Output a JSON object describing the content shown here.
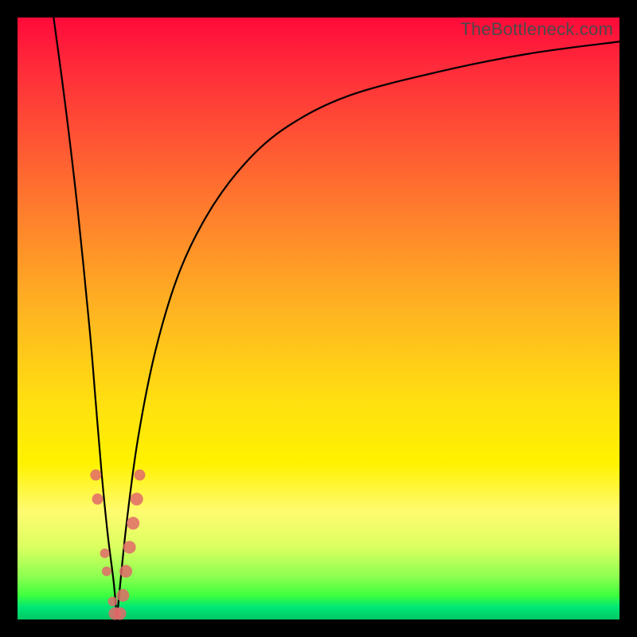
{
  "watermark": "TheBottleneck.com",
  "colors": {
    "frame_border": "#000000",
    "curve": "#000000",
    "dot": "#e06a6a",
    "gradient_top": "#ff0a3a",
    "gradient_bottom": "#00c864"
  },
  "chart_data": {
    "type": "line",
    "title": "",
    "xlabel": "",
    "ylabel": "",
    "xlim": [
      0,
      100
    ],
    "ylim": [
      0,
      100
    ],
    "grid": false,
    "legend": false,
    "series": [
      {
        "name": "left-branch",
        "x": [
          6,
          8,
          10,
          12,
          13,
          14,
          15,
          16,
          16.5
        ],
        "y": [
          100,
          85,
          68,
          48,
          36,
          24,
          14,
          6,
          0
        ]
      },
      {
        "name": "right-branch",
        "x": [
          16.5,
          18,
          20,
          23,
          27,
          32,
          38,
          45,
          55,
          70,
          85,
          100
        ],
        "y": [
          0,
          15,
          30,
          45,
          58,
          68,
          76,
          82,
          87,
          91,
          94,
          96
        ]
      }
    ],
    "dots": {
      "name": "highlight-points",
      "points": [
        {
          "x": 13.0,
          "y": 24,
          "r": 7
        },
        {
          "x": 13.3,
          "y": 20,
          "r": 7
        },
        {
          "x": 14.5,
          "y": 11,
          "r": 6
        },
        {
          "x": 14.8,
          "y": 8,
          "r": 6
        },
        {
          "x": 15.8,
          "y": 3,
          "r": 6
        },
        {
          "x": 16.2,
          "y": 1,
          "r": 8
        },
        {
          "x": 17.0,
          "y": 1,
          "r": 8
        },
        {
          "x": 17.5,
          "y": 4,
          "r": 8
        },
        {
          "x": 18.0,
          "y": 8,
          "r": 8
        },
        {
          "x": 18.6,
          "y": 12,
          "r": 8
        },
        {
          "x": 19.2,
          "y": 16,
          "r": 8
        },
        {
          "x": 19.8,
          "y": 20,
          "r": 8
        },
        {
          "x": 20.3,
          "y": 24,
          "r": 7
        }
      ]
    }
  }
}
